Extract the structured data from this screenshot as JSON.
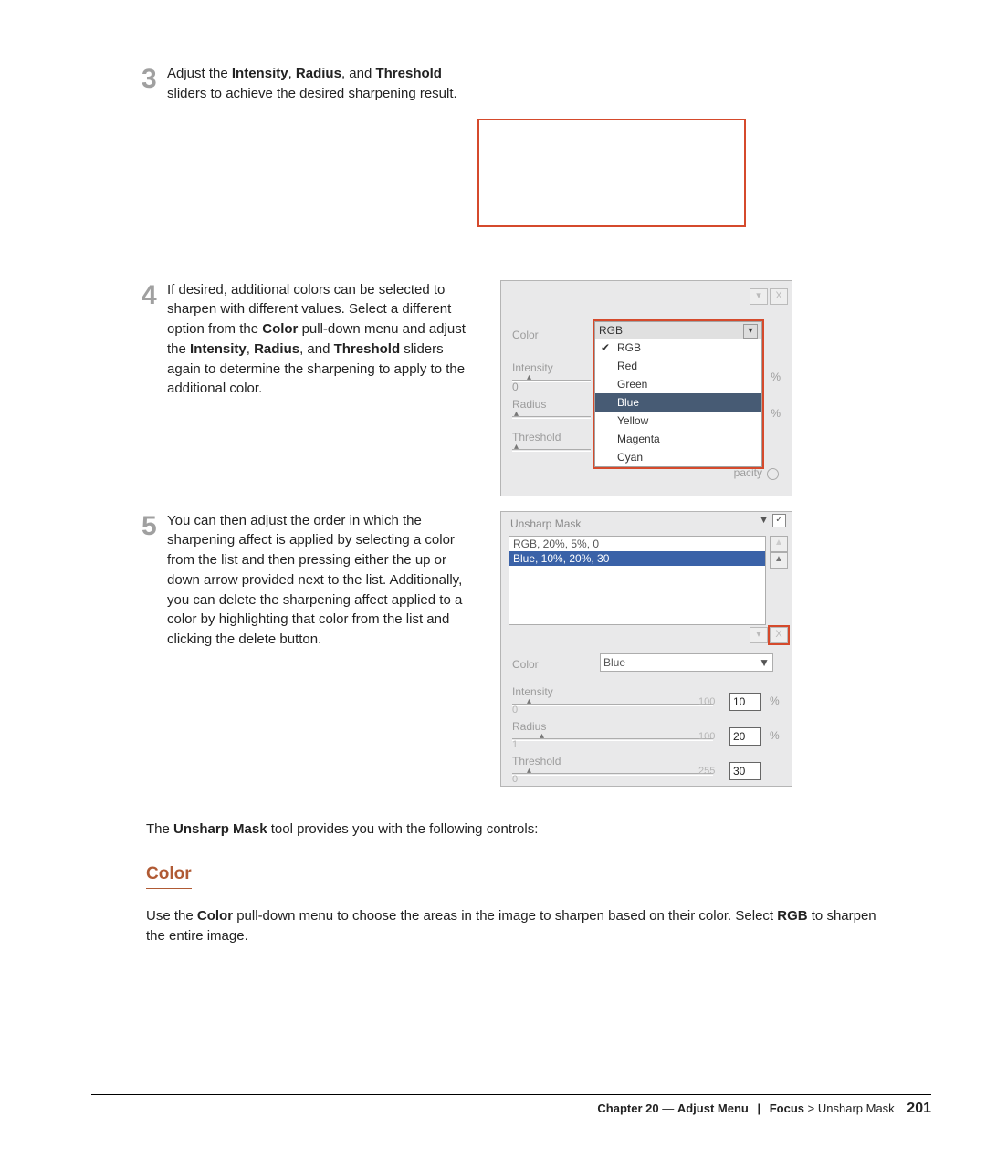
{
  "steps": {
    "s3": {
      "num": "3",
      "text_before_b1": "Adjust the ",
      "b1": "Intensity",
      "comma1": ", ",
      "b2": "Radius",
      "and": ", and ",
      "b3": "Threshold",
      "text_after": " sliders to achieve the desired sharpening result."
    },
    "s4": {
      "num": "4",
      "t1": "If desired, additional colors can be selected to sharpen with different values. Select a different option from the ",
      "b1": "Color",
      "t2": " pull-down menu and adjust the ",
      "b2": "Intensity",
      "c1": ", ",
      "b3": "Radius",
      "c2": ", and ",
      "b4": "Threshold",
      "t3": " sliders again to determine the sharpening to apply to the additional color."
    },
    "s5": {
      "num": "5",
      "text": "You can then adjust the order in which the sharpening affect is applied by selecting a color from the list and then pressing either the up or down arrow provided next to the list. Additionally, you can delete the sharpening affect applied to a color by highlighting that color from the list and clicking the delete button."
    }
  },
  "panel4": {
    "close_icon": "X",
    "dropdown_caret": "▾",
    "color_label": "Color",
    "intensity_label": "Intensity",
    "radius_label": "Radius",
    "threshold_label": "Threshold",
    "intensity_min": "0",
    "pct": "%",
    "opacity_label": "pacity",
    "dropdown_head": "RGB",
    "options": [
      "RGB",
      "Red",
      "Green",
      "Blue",
      "Yellow",
      "Magenta",
      "Cyan"
    ],
    "checked_index": 0,
    "selected_index": 3,
    "check_glyph": "✔"
  },
  "panel5": {
    "title": "Unsharp Mask",
    "title_caret": "▼",
    "cb_glyph": "✓",
    "list_rows": [
      "RGB, 20%, 5%, 0",
      "Blue, 10%, 20%, 30"
    ],
    "selected_row": 1,
    "arrow_up": "▲",
    "arrow_down": "▼",
    "del_caret": "▾",
    "close_icon": "X",
    "color_label": "Color",
    "color_value": "Blue",
    "color_caret": "▼",
    "intensity_label": "Intensity",
    "intensity_min": "0",
    "intensity_max": "100",
    "intensity_val": "10",
    "radius_label": "Radius",
    "radius_min": "1",
    "radius_max": "100",
    "radius_val": "20",
    "threshold_label": "Threshold",
    "threshold_min": "0",
    "threshold_max": "255",
    "threshold_val": "30",
    "pct": "%"
  },
  "copy": {
    "intro_before_b": "The ",
    "intro_b": "Unsharp Mask",
    "intro_after_b": " tool provides you with the following controls:",
    "section_h": "Color",
    "color_t1": "Use the ",
    "color_b1": "Color",
    "color_t2": " pull-down menu to choose the areas in the image to sharpen based on their color. Select ",
    "color_b2": "RGB",
    "color_t3": " to sharpen the entire image."
  },
  "footer": {
    "chapter": "Chapter 20",
    "dash": " — ",
    "section": "Adjust Menu",
    "bar": "|",
    "breadcrumb1": "Focus",
    "gt": ">",
    "breadcrumb2": "Unsharp Mask",
    "page": "201"
  }
}
